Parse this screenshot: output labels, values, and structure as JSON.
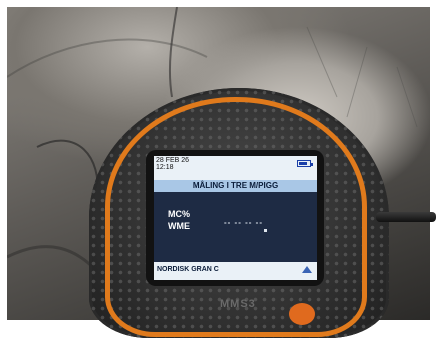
{
  "device": {
    "brand": "MMS3",
    "colors": {
      "accent": "#e07a1c",
      "screen_bg": "#eaf1f7",
      "title_bar": "#a9c7e6",
      "screen_mid": "#1e2b44"
    }
  },
  "screen": {
    "date": "28 FEB 26",
    "time": "12:18",
    "title": "MÅLING I TRE M/PIGG",
    "labels": {
      "mc": "MC%",
      "wme": "WME"
    },
    "value_placeholder": "-- -- --   --",
    "material": "NORDISK GRAN C",
    "icons": {
      "battery": "battery-icon",
      "menu_triangle": "triangle-up-icon"
    }
  }
}
